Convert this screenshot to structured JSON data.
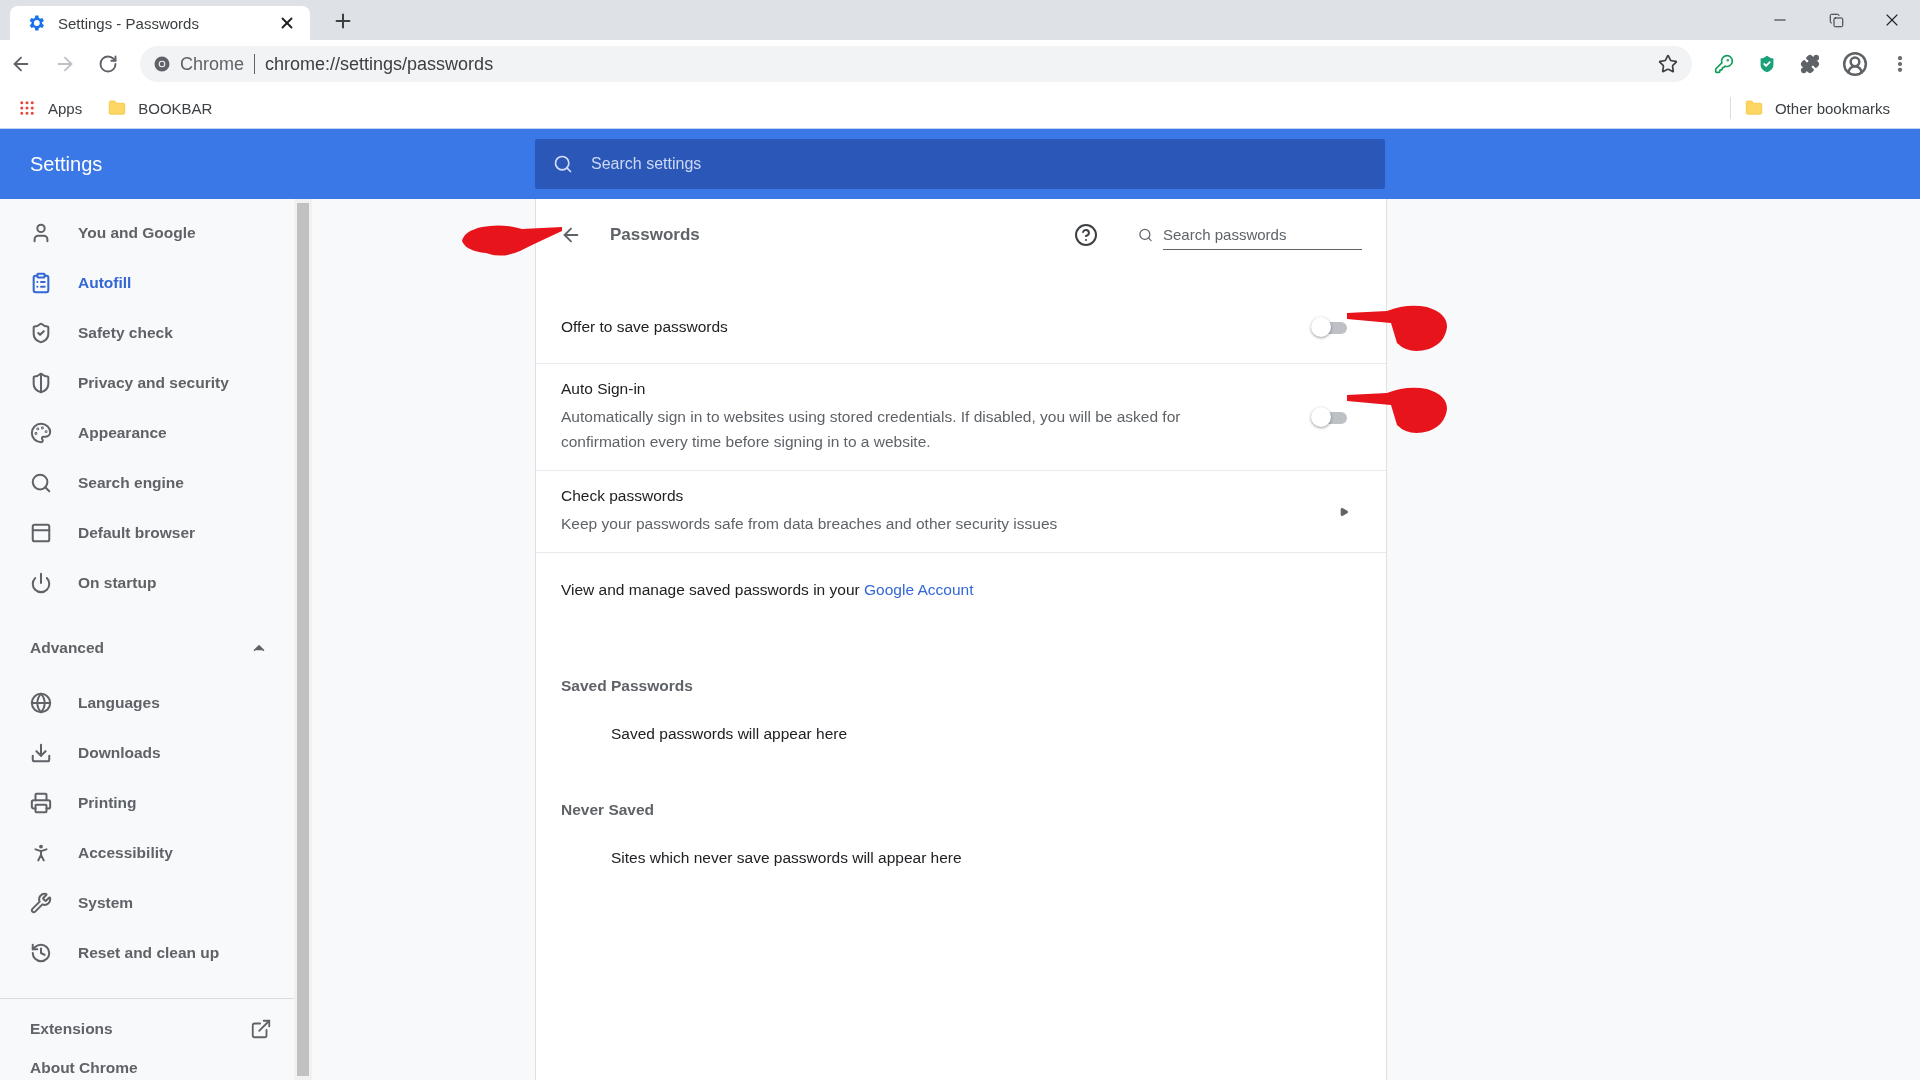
{
  "browser": {
    "tab": {
      "title": "Settings - Passwords"
    },
    "omnibox": {
      "site": "Chrome",
      "url": "chrome://settings/passwords"
    },
    "bookmarks": [
      {
        "label": "Apps",
        "kind": "apps"
      },
      {
        "label": "BOOKBAR",
        "kind": "folder"
      }
    ],
    "other_bookmarks": "Other bookmarks"
  },
  "header": {
    "title": "Settings",
    "search": {
      "placeholder": "Search settings"
    }
  },
  "sidebar": {
    "items": [
      {
        "label": "You and Google",
        "selected": false
      },
      {
        "label": "Autofill",
        "selected": true
      },
      {
        "label": "Safety check",
        "selected": false
      },
      {
        "label": "Privacy and security",
        "selected": false
      },
      {
        "label": "Appearance",
        "selected": false
      },
      {
        "label": "Search engine",
        "selected": false
      },
      {
        "label": "Default browser",
        "selected": false
      },
      {
        "label": "On startup",
        "selected": false
      }
    ],
    "advanced": {
      "label": "Advanced",
      "expanded": true,
      "items": [
        {
          "label": "Languages",
          "selected": false
        },
        {
          "label": "Downloads",
          "selected": false
        },
        {
          "label": "Printing",
          "selected": false
        },
        {
          "label": "Accessibility",
          "selected": false
        },
        {
          "label": "System",
          "selected": false
        },
        {
          "label": "Reset and clean up",
          "selected": false
        }
      ]
    },
    "extensions": "Extensions",
    "about": "About Chrome"
  },
  "page": {
    "title": "Passwords",
    "search": {
      "placeholder": "Search passwords"
    },
    "settings": [
      {
        "kind": "toggle",
        "title": "Offer to save passwords",
        "on": false
      },
      {
        "kind": "toggle",
        "title": "Auto Sign-in",
        "description": "Automatically sign in to websites using stored credentials. If disabled, you will be asked for confirmation every time before signing in to a website.",
        "on": false
      },
      {
        "kind": "link",
        "title": "Check passwords",
        "description": "Keep your passwords safe from data breaches and other security issues"
      }
    ],
    "account_text": "View and manage saved passwords in your",
    "account_link": "Google Account",
    "sections": [
      {
        "heading": "Saved Passwords",
        "empty": "Saved passwords will appear here"
      },
      {
        "heading": "Never Saved",
        "empty": "Sites which never save passwords will appear here"
      }
    ]
  }
}
